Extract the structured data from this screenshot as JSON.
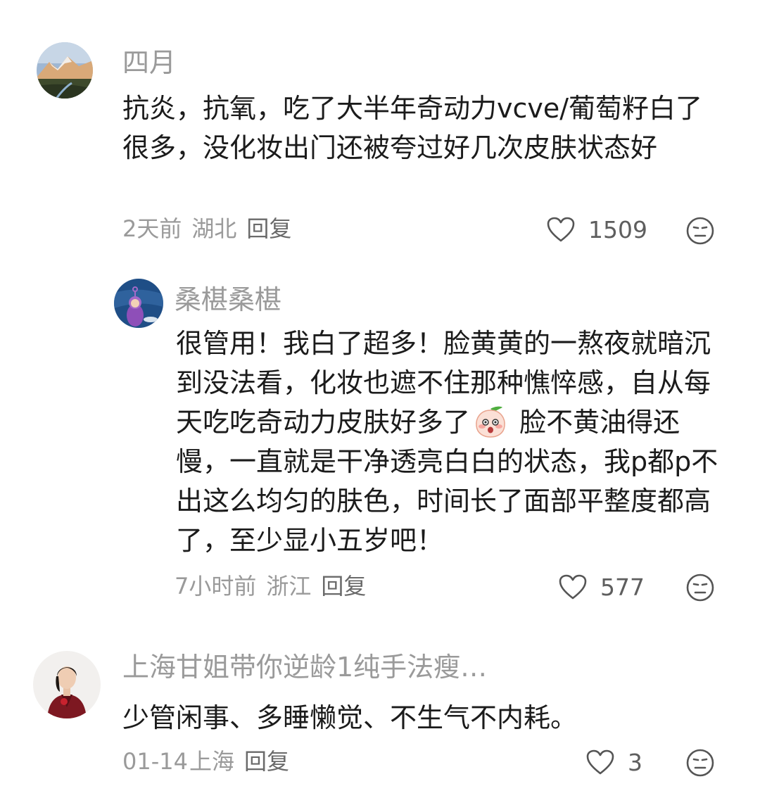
{
  "comments": [
    {
      "author": "四月",
      "text": "抗炎，抗氧，吃了大半年奇动力vcve/葡萄籽白了很多，没化妆出门还被夸过好几次皮肤状态好",
      "time": "2天前",
      "location": "湖北",
      "reply_label": "回复",
      "likes": "1509"
    },
    {
      "author": "桑椹桑椹",
      "text_part1": "很管用！我白了超多！脸黄黄的一熬夜就暗沉到没法看，化妆也遮不住那种憔悴感，自从每天吃吃奇动力皮肤好多了",
      "text_part2": " 脸不黄油得还慢，一直就是干净透亮白白的状态，我p都p不出这么均匀的肤色，时间长了面部平整度都高了，至少显小五岁吧！",
      "time": "7小时前",
      "location": "浙江",
      "reply_label": "回复",
      "likes": "577"
    },
    {
      "author": "上海甘姐带你逆龄1纯手法瘦…",
      "text": "少管闲事、多睡懒觉、不生气不内耗。",
      "time": "01-14",
      "location": "上海",
      "reply_label": "回复",
      "likes": "3"
    }
  ]
}
